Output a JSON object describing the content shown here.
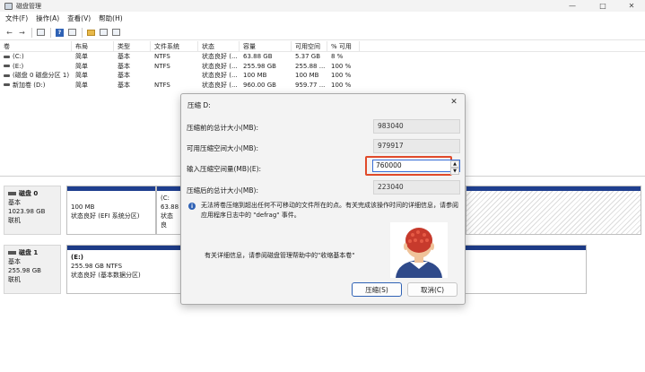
{
  "window": {
    "title": "磁盘管理"
  },
  "menu": [
    "文件(F)",
    "操作(A)",
    "查看(V)",
    "帮助(H)"
  ],
  "toolbar_icons": [
    "back-icon",
    "forward-icon",
    "list-icon",
    "help-icon",
    "properties-icon",
    "folder-icon",
    "window-icon"
  ],
  "volume_table": {
    "columns": [
      "卷",
      "布局",
      "类型",
      "文件系统",
      "状态",
      "容量",
      "可用空间",
      "% 可用"
    ],
    "rows": [
      [
        "(C:)",
        "简单",
        "基本",
        "NTFS",
        "状态良好 (...",
        "63.88 GB",
        "5.37 GB",
        "8 %"
      ],
      [
        "(E:)",
        "简单",
        "基本",
        "NTFS",
        "状态良好 (...",
        "255.98 GB",
        "255.88 ...",
        "100 %"
      ],
      [
        "(磁盘 0 磁盘分区 1)",
        "简单",
        "基本",
        "",
        "状态良好 (...",
        "100 MB",
        "100 MB",
        "100 %"
      ],
      [
        "新加卷 (D:)",
        "简单",
        "基本",
        "NTFS",
        "状态良好 (...",
        "960.00 GB",
        "959.77 ...",
        "100 %"
      ]
    ]
  },
  "disks": [
    {
      "name": "磁盘 0",
      "type": "基本",
      "size": "1023.98 GB",
      "status": "联机",
      "partitions": [
        {
          "title": "",
          "line1": "100 MB",
          "line2": "状态良好 (EFI 系统分区)"
        },
        {
          "title": "(C:",
          "line1": "63.88",
          "line2": "状态良"
        }
      ]
    },
    {
      "name": "磁盘 1",
      "type": "基本",
      "size": "255.98 GB",
      "status": "联机",
      "partitions": [
        {
          "title": "(E:)",
          "line1": "255.98 GB NTFS",
          "line2": "状态良好 (基本数据分区)"
        }
      ]
    }
  ],
  "dialog": {
    "title": "压缩 D:",
    "labels": {
      "total_before": "压缩前的总计大小(MB):",
      "available": "可用压缩空间大小(MB):",
      "input": "输入压缩空间量(MB)(E):",
      "total_after": "压缩后的总计大小(MB):"
    },
    "values": {
      "total_before": "983040",
      "available": "979917",
      "input": "760000",
      "total_after": "223040"
    },
    "info_text": "无法将卷压缩到超出任何不可移动的文件所在的点。有关完成该操作时间的详细信息，请参阅应用程序日志中的 \"defrag\" 事件。",
    "help_text": "有关详细信息，请参阅磁盘管理帮助中的\"收缩基本卷\"",
    "buttons": {
      "shrink": "压缩(S)",
      "cancel": "取消(C)"
    }
  },
  "colors": {
    "partition_bar": "#1f3f8f",
    "highlight": "#e04a2a",
    "accent": "#2f62b5"
  }
}
